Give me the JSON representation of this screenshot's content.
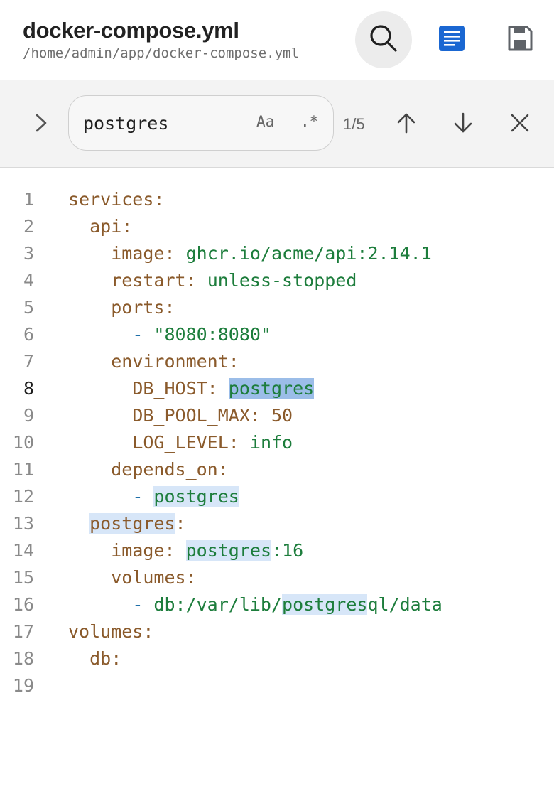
{
  "header": {
    "title": "docker-compose.yml",
    "path": "/home/admin/app/docker-compose.yml",
    "icons": {
      "search": "search-icon",
      "wrap": "wrap-text-icon",
      "save": "save-icon"
    },
    "colors": {
      "wrap_accent": "#1a67d2"
    }
  },
  "find": {
    "query": "postgres",
    "case_label": "Aa",
    "regex_label": ".*",
    "match_count": "1/5",
    "icons": {
      "expand": "chevron-right-icon",
      "prev": "arrow-up-icon",
      "next": "arrow-down-icon",
      "close": "close-icon"
    }
  },
  "editor": {
    "active_line": 8,
    "line_numbers": [
      "1",
      "2",
      "3",
      "4",
      "5",
      "6",
      "7",
      "8",
      "9",
      "10",
      "11",
      "12",
      "13",
      "14",
      "15",
      "16",
      "17",
      "18",
      "19"
    ],
    "lines": [
      [
        {
          "t": "services",
          "c": "k"
        },
        {
          "t": ":",
          "c": "k"
        }
      ],
      [
        {
          "t": "  "
        },
        {
          "t": "api",
          "c": "k"
        },
        {
          "t": ":",
          "c": "k"
        }
      ],
      [
        {
          "t": "    "
        },
        {
          "t": "image",
          "c": "k"
        },
        {
          "t": ": ",
          "c": "k"
        },
        {
          "t": "ghcr.io/acme/api:2.14.1",
          "c": "v"
        }
      ],
      [
        {
          "t": "    "
        },
        {
          "t": "restart",
          "c": "k"
        },
        {
          "t": ": ",
          "c": "k"
        },
        {
          "t": "unless-stopped",
          "c": "v"
        }
      ],
      [
        {
          "t": "    "
        },
        {
          "t": "ports",
          "c": "k"
        },
        {
          "t": ":",
          "c": "k"
        }
      ],
      [
        {
          "t": "      "
        },
        {
          "t": "- ",
          "c": "p"
        },
        {
          "t": "\"8080:8080\"",
          "c": "v"
        }
      ],
      [
        {
          "t": "    "
        },
        {
          "t": "environment",
          "c": "k"
        },
        {
          "t": ":",
          "c": "k"
        }
      ],
      [
        {
          "t": "      "
        },
        {
          "t": "DB_HOST",
          "c": "k"
        },
        {
          "t": ": ",
          "c": "k"
        },
        {
          "t": "postgres",
          "c": "v",
          "m": "current"
        }
      ],
      [
        {
          "t": "      "
        },
        {
          "t": "DB_POOL_MAX",
          "c": "k"
        },
        {
          "t": ": ",
          "c": "k"
        },
        {
          "t": "50",
          "c": "k"
        }
      ],
      [
        {
          "t": "      "
        },
        {
          "t": "LOG_LEVEL",
          "c": "k"
        },
        {
          "t": ": ",
          "c": "k"
        },
        {
          "t": "info",
          "c": "v"
        }
      ],
      [
        {
          "t": "    "
        },
        {
          "t": "depends_on",
          "c": "k"
        },
        {
          "t": ":",
          "c": "k"
        }
      ],
      [
        {
          "t": "      "
        },
        {
          "t": "- ",
          "c": "p"
        },
        {
          "t": "postgres",
          "c": "v",
          "m": "match"
        }
      ],
      [
        {
          "t": "  "
        },
        {
          "t": "postgres",
          "c": "k",
          "m": "match"
        },
        {
          "t": ":",
          "c": "k"
        }
      ],
      [
        {
          "t": "    "
        },
        {
          "t": "image",
          "c": "k"
        },
        {
          "t": ": ",
          "c": "k"
        },
        {
          "t": "postgres",
          "c": "v",
          "m": "match"
        },
        {
          "t": ":16",
          "c": "v"
        }
      ],
      [
        {
          "t": "    "
        },
        {
          "t": "volumes",
          "c": "k"
        },
        {
          "t": ":",
          "c": "k"
        }
      ],
      [
        {
          "t": "      "
        },
        {
          "t": "- ",
          "c": "p"
        },
        {
          "t": "db:/var/lib/",
          "c": "v"
        },
        {
          "t": "postgres",
          "c": "v",
          "m": "match"
        },
        {
          "t": "ql/data",
          "c": "v"
        }
      ],
      [
        {
          "t": "volumes",
          "c": "k"
        },
        {
          "t": ":",
          "c": "k"
        }
      ],
      [
        {
          "t": "  "
        },
        {
          "t": "db",
          "c": "k"
        },
        {
          "t": ":",
          "c": "k"
        }
      ],
      []
    ]
  }
}
